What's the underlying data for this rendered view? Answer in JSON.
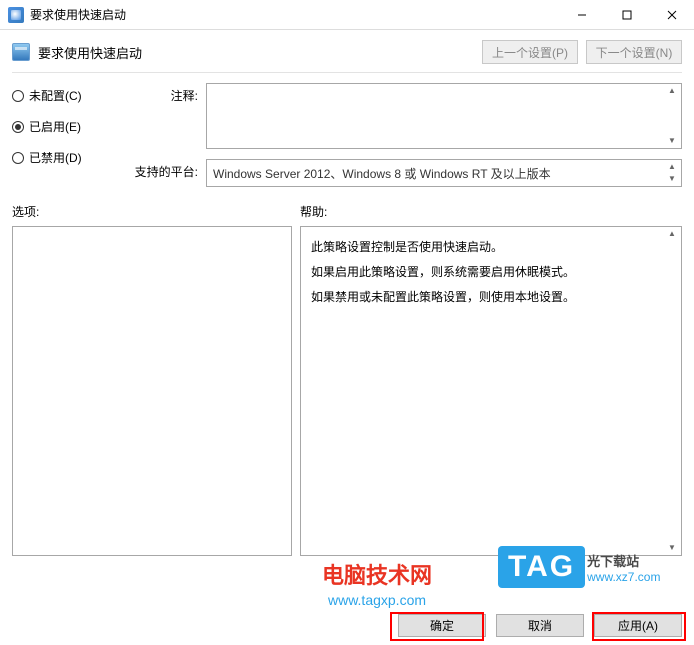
{
  "titlebar": {
    "title": "要求使用快速启动"
  },
  "header": {
    "title": "要求使用快速启动",
    "prev_btn": "上一个设置(P)",
    "next_btn": "下一个设置(N)"
  },
  "radios": {
    "not_configured": "未配置(C)",
    "enabled": "已启用(E)",
    "disabled": "已禁用(D)",
    "selected": "enabled"
  },
  "fields": {
    "comment_label": "注释:",
    "comment_value": "",
    "platform_label": "支持的平台:",
    "platform_value": "Windows Server 2012、Windows 8 或 Windows RT 及以上版本"
  },
  "sections": {
    "options_label": "选项:",
    "help_label": "帮助:"
  },
  "help": {
    "p1": "此策略设置控制是否使用快速启动。",
    "p2": "如果启用此策略设置，则系统需要启用休眠模式。",
    "p3": "如果禁用或未配置此策略设置，则使用本地设置。"
  },
  "buttons": {
    "ok": "确定",
    "cancel": "取消",
    "apply": "应用(A)"
  },
  "watermarks": {
    "wm1_text": "电脑技术网",
    "wm1_url": "www.tagxp.com",
    "wm2_tag": "TAG",
    "wm2_text": "光下载站",
    "wm2_url": "www.xz7.com"
  }
}
